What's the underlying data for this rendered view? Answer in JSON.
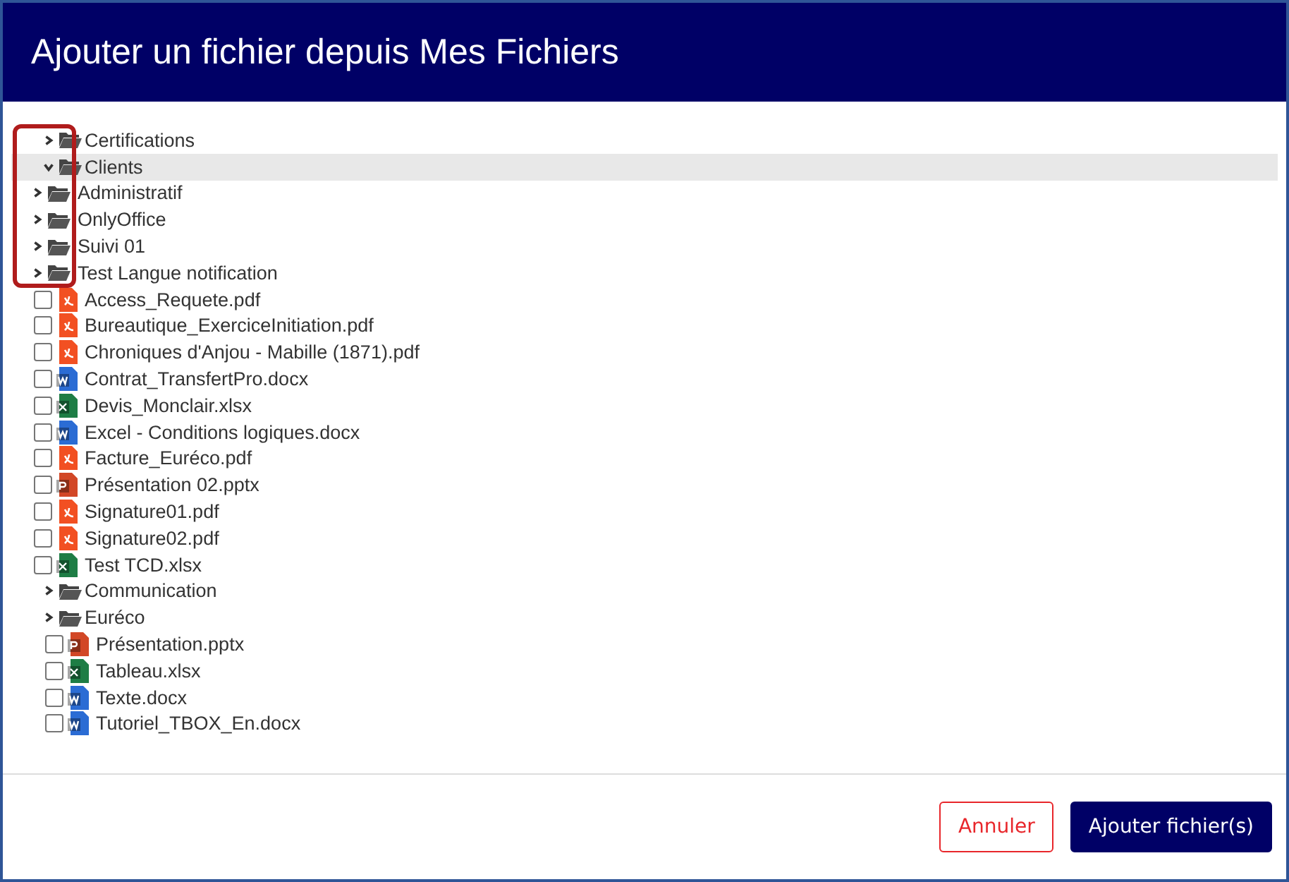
{
  "dialog": {
    "title": "Ajouter un fichier depuis Mes Fichiers"
  },
  "tree": [
    {
      "kind": "folder",
      "name": "Certifications",
      "expanded": false,
      "selected": false
    },
    {
      "kind": "folder",
      "name": "Clients",
      "expanded": true,
      "selected": true,
      "children": [
        {
          "kind": "folder",
          "name": "Administratif",
          "expanded": false,
          "selected": false
        },
        {
          "kind": "folder",
          "name": "OnlyOffice",
          "expanded": false,
          "selected": false
        },
        {
          "kind": "folder",
          "name": "Suivi 01",
          "expanded": false,
          "selected": false
        },
        {
          "kind": "folder",
          "name": "Test Langue notification",
          "expanded": false,
          "selected": false
        },
        {
          "kind": "pdf",
          "name": "Access_Requete.pdf",
          "checked": false
        },
        {
          "kind": "pdf",
          "name": "Bureautique_ExerciceInitiation.pdf",
          "checked": false
        },
        {
          "kind": "pdf",
          "name": "Chroniques d'Anjou - Mabille (1871).pdf",
          "checked": false
        },
        {
          "kind": "docx",
          "name": "Contrat_TransfertPro.docx",
          "checked": false
        },
        {
          "kind": "xlsx",
          "name": "Devis_Monclair.xlsx",
          "checked": false
        },
        {
          "kind": "docx",
          "name": "Excel - Conditions logiques.docx",
          "checked": false
        },
        {
          "kind": "pdf",
          "name": "Facture_Euréco.pdf",
          "checked": false
        },
        {
          "kind": "pptx",
          "name": "Présentation 02.pptx",
          "checked": false
        },
        {
          "kind": "pdf",
          "name": "Signature01.pdf",
          "checked": false
        },
        {
          "kind": "pdf",
          "name": "Signature02.pdf",
          "checked": false
        },
        {
          "kind": "xlsx",
          "name": "Test TCD.xlsx",
          "checked": false
        }
      ]
    },
    {
      "kind": "folder",
      "name": "Communication",
      "expanded": false,
      "selected": false
    },
    {
      "kind": "folder",
      "name": "Euréco",
      "expanded": false,
      "selected": false
    },
    {
      "kind": "pptx",
      "name": "Présentation.pptx",
      "checked": false
    },
    {
      "kind": "xlsx",
      "name": "Tableau.xlsx",
      "checked": false
    },
    {
      "kind": "docx",
      "name": "Texte.docx",
      "checked": false
    },
    {
      "kind": "docx",
      "name": "Tutoriel_TBOX_En.docx",
      "checked": false
    }
  ],
  "buttons": [
    {
      "kind": "secondary",
      "label": "Annuler"
    },
    {
      "kind": "primary",
      "label": "Ajouter fichier(s)"
    }
  ]
}
